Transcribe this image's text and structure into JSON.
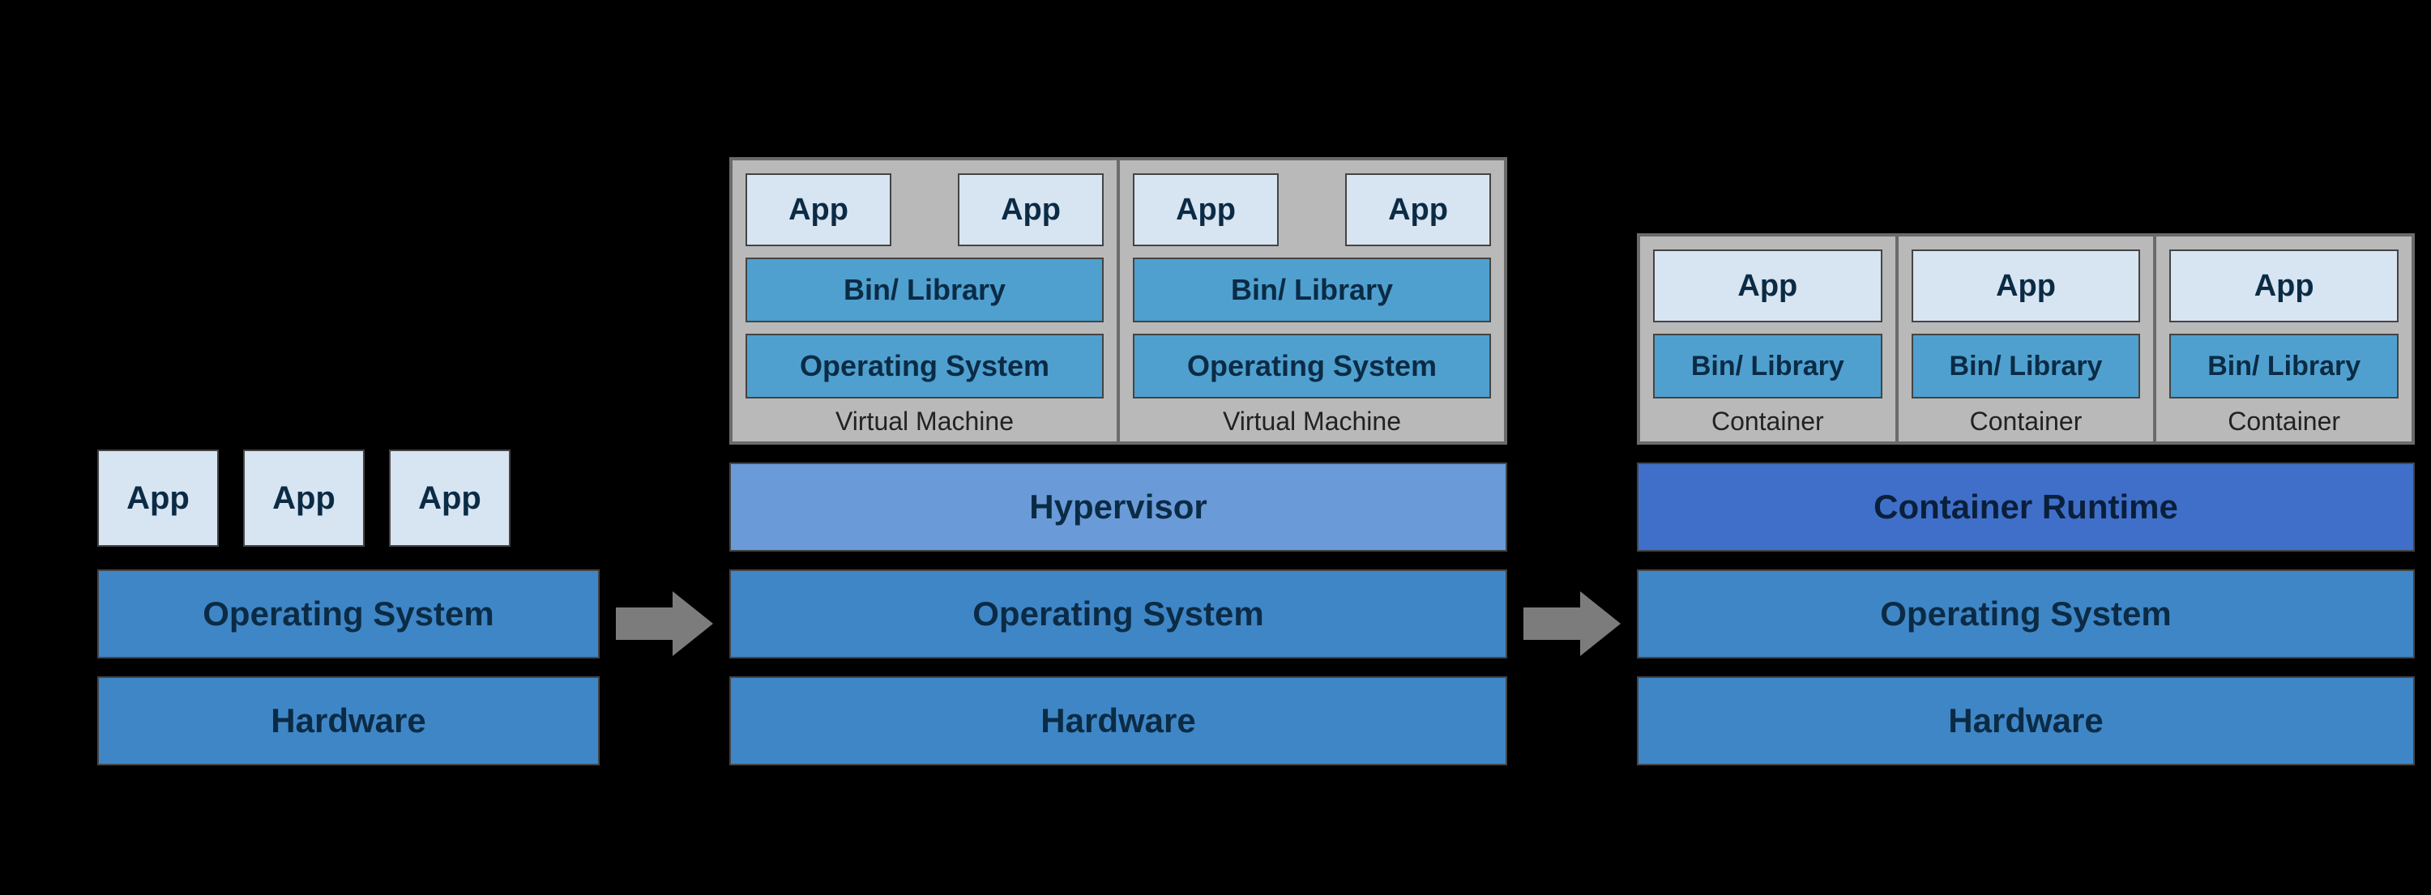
{
  "labels": {
    "app": "App",
    "os": "Operating System",
    "hw": "Hardware",
    "hypervisor": "Hypervisor",
    "binlib": "Bin/ Library",
    "vm": "Virtual Machine",
    "container": "Container",
    "runtime": "Container Runtime"
  },
  "columns": {
    "traditional": {
      "apps": [
        "app",
        "app",
        "app"
      ],
      "layers": [
        "os",
        "hw"
      ]
    },
    "vm": {
      "vms": [
        {
          "apps": [
            "app",
            "app"
          ],
          "layers": [
            "binlib",
            "os"
          ],
          "label": "vm"
        },
        {
          "apps": [
            "app",
            "app"
          ],
          "layers": [
            "binlib",
            "os"
          ],
          "label": "vm"
        }
      ],
      "layers": [
        "hypervisor",
        "os",
        "hw"
      ]
    },
    "container": {
      "containers": [
        {
          "app": "app",
          "binlib": "binlib",
          "label": "container"
        },
        {
          "app": "app",
          "binlib": "binlib",
          "label": "container"
        },
        {
          "app": "app",
          "binlib": "binlib",
          "label": "container"
        }
      ],
      "layers": [
        "runtime",
        "os",
        "hw"
      ]
    }
  }
}
